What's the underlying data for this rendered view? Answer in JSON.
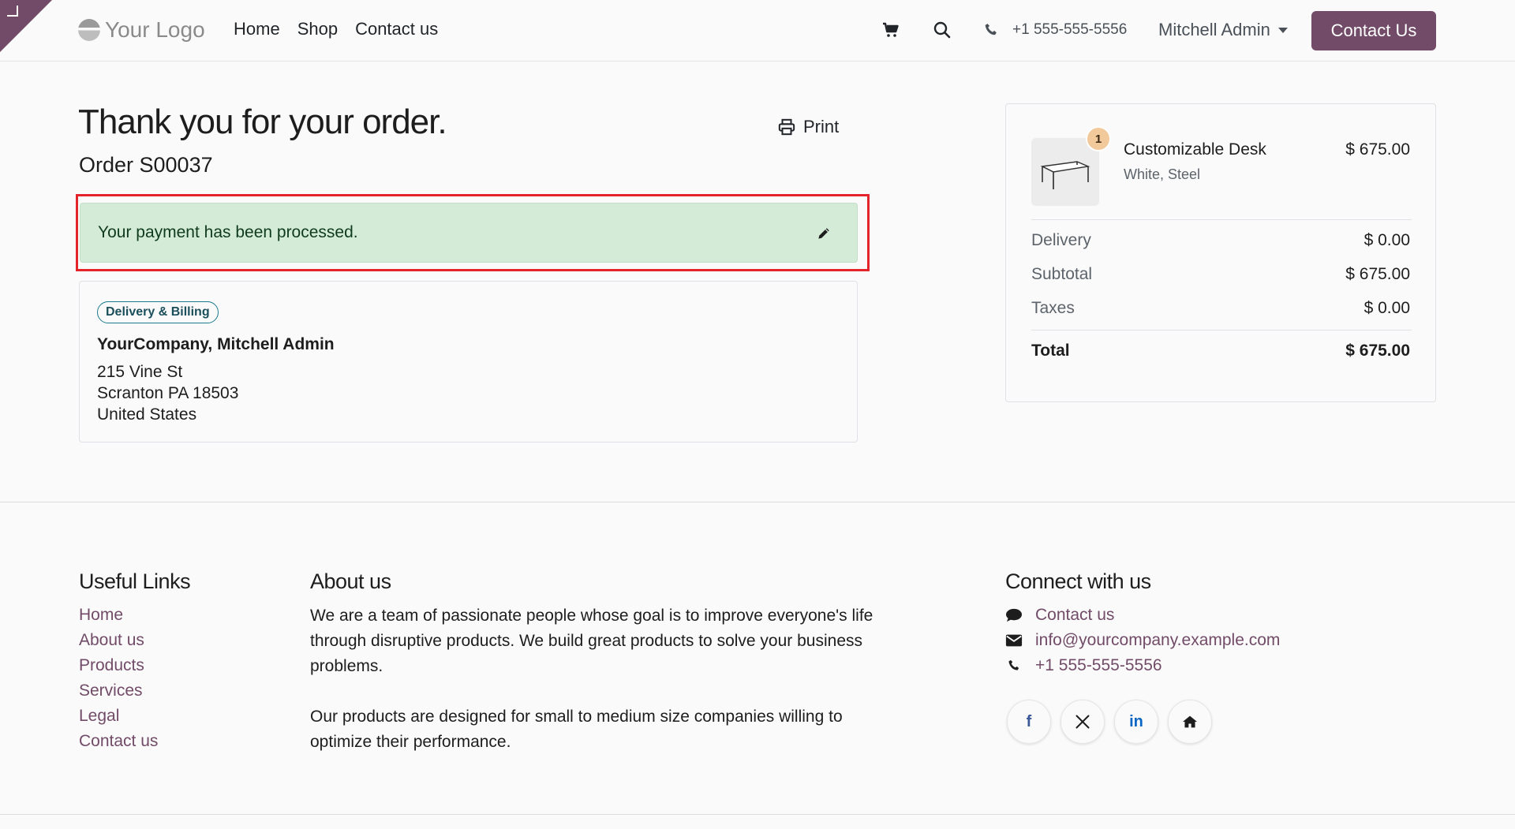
{
  "header": {
    "logo_text": "Your Logo",
    "nav": [
      "Home",
      "Shop",
      "Contact us"
    ],
    "phone": "+1 555-555-5556",
    "user": "Mitchell Admin",
    "cta": "Contact Us"
  },
  "order": {
    "title": "Thank you for your order.",
    "order_number": "Order S00037",
    "print_label": "Print",
    "alert": "Your payment has been processed."
  },
  "address": {
    "badge": "Delivery & Billing",
    "name": "YourCompany, Mitchell Admin",
    "lines": [
      "215 Vine St",
      "Scranton PA 18503",
      "United States"
    ]
  },
  "summary": {
    "product": {
      "quantity": "1",
      "name": "Customizable Desk",
      "variant": "White, Steel",
      "price": "$ 675.00"
    },
    "rows": [
      {
        "label": "Delivery",
        "value": "$ 0.00"
      },
      {
        "label": "Subtotal",
        "value": "$ 675.00"
      },
      {
        "label": "Taxes",
        "value": "$ 0.00"
      }
    ],
    "total_label": "Total",
    "total_value": "$ 675.00"
  },
  "footer": {
    "useful_links_title": "Useful Links",
    "useful_links": [
      "Home",
      "About us",
      "Products",
      "Services",
      "Legal",
      "Contact us"
    ],
    "about_title": "About us",
    "about_p1": "We are a team of passionate people whose goal is to improve everyone's life through disruptive products. We build great products to solve your business problems.",
    "about_p2": "Our products are designed for small to medium size companies willing to optimize their performance.",
    "connect_title": "Connect with us",
    "connect": [
      "Contact us",
      "info@yourcompany.example.com",
      "+1 555-555-5556"
    ],
    "social": [
      "f",
      "in"
    ]
  },
  "colors": {
    "brand": "#714B67",
    "alert_bg": "#d4ebd8",
    "highlight": "#e3242b"
  }
}
